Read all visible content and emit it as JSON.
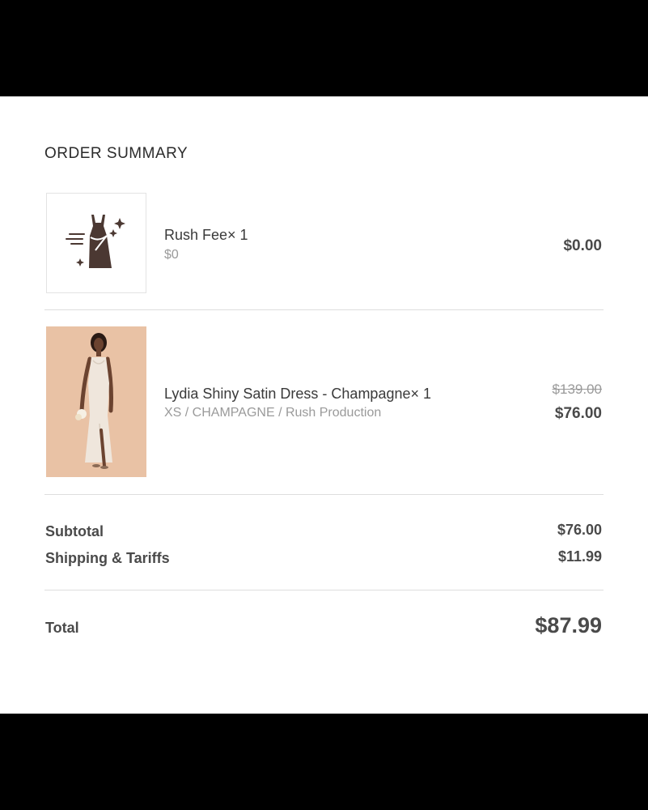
{
  "summary": {
    "heading": "ORDER SUMMARY"
  },
  "items": [
    {
      "name": "Rush Fee× 1",
      "detail": "$0",
      "price": "$0.00",
      "image_icon": "rush-dress-icon"
    },
    {
      "name": "Lydia Shiny Satin Dress - Champagne× 1",
      "detail": "XS / CHAMPAGNE / Rush Production",
      "original_price": "$139.00",
      "price": "$76.00",
      "image_icon": "dress-photo"
    }
  ],
  "totals": {
    "subtotal_label": "Subtotal",
    "subtotal_value": "$76.00",
    "shipping_label": "Shipping & Tariffs",
    "shipping_value": "$11.99",
    "total_label": "Total",
    "total_value": "$87.99"
  },
  "colors": {
    "frame": "#000000",
    "panel": "#ffffff",
    "icon": "#4b3832",
    "photo_background": "#e9c2a5"
  }
}
